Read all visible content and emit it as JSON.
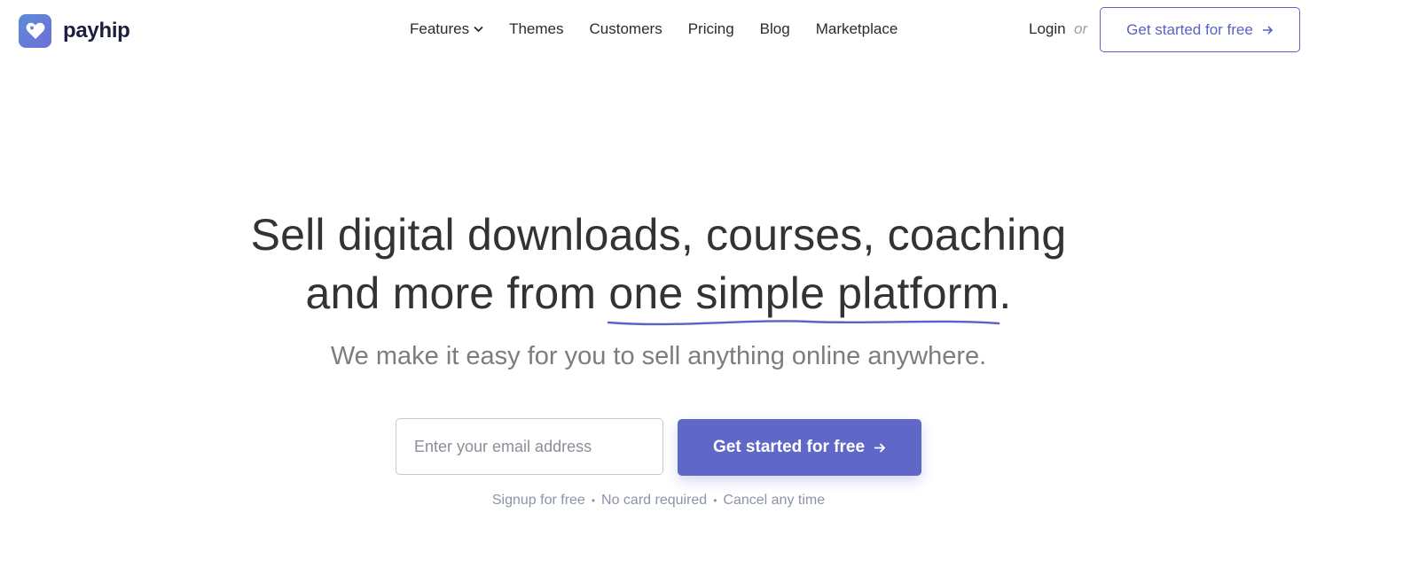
{
  "brand": {
    "name": "payhip",
    "logo_icon": "heart-tag-icon",
    "accent_color": "#5f68c6"
  },
  "nav": {
    "items": [
      {
        "label": "Features",
        "has_dropdown": true
      },
      {
        "label": "Themes"
      },
      {
        "label": "Customers"
      },
      {
        "label": "Pricing"
      },
      {
        "label": "Blog"
      },
      {
        "label": "Marketplace"
      }
    ],
    "login_label": "Login",
    "or_label": "or",
    "cta_label": "Get started for free"
  },
  "hero": {
    "title_line1": "Sell digital downloads, courses, coaching",
    "title_line2_prefix": "and more from ",
    "title_highlight": "one simple platform",
    "title_line2_suffix": ".",
    "subtitle": "We make it easy for you to sell anything online anywhere."
  },
  "signup": {
    "email_placeholder": "Enter your email address",
    "email_value": "",
    "cta_label": "Get started for free",
    "notes": [
      "Signup for free",
      "No card required",
      "Cancel any time"
    ]
  }
}
